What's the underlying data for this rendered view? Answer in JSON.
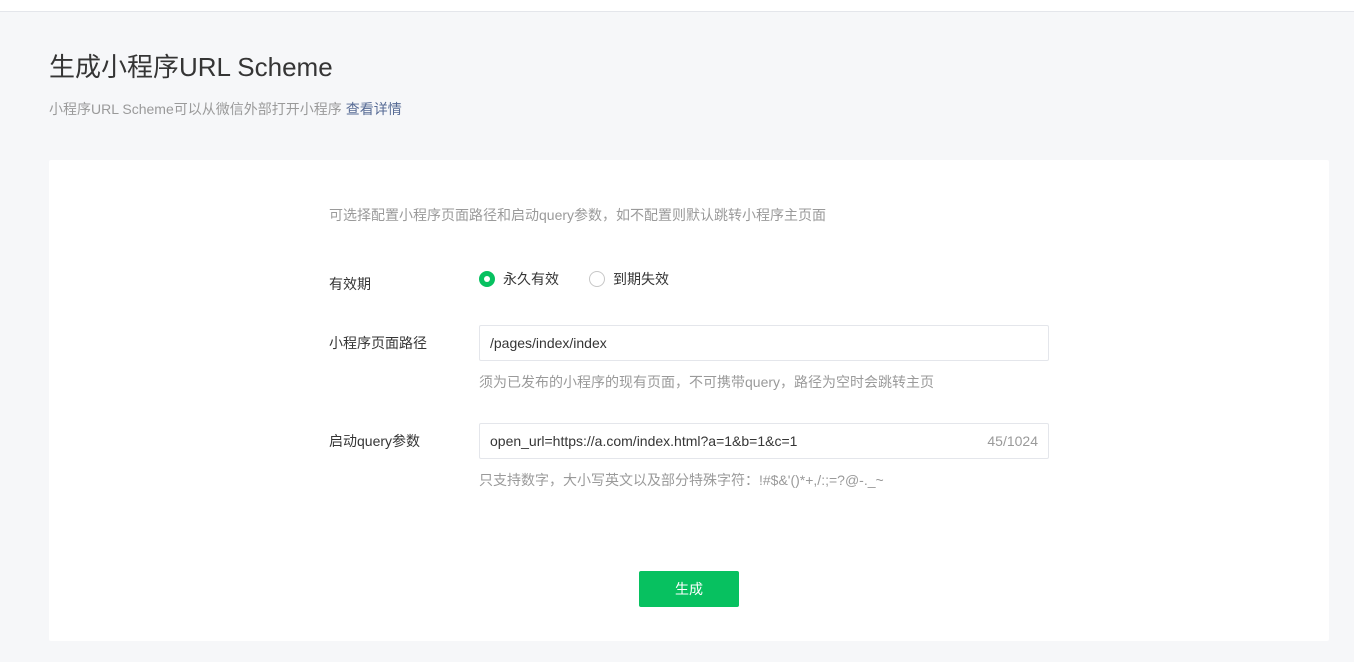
{
  "header": {
    "title": "生成小程序URL Scheme",
    "subtitle": "小程序URL Scheme可以从微信外部打开小程序",
    "details_link": "查看详情"
  },
  "form": {
    "hint": "可选择配置小程序页面路径和启动query参数，如不配置则默认跳转小程序主页面",
    "validity": {
      "label": "有效期",
      "options": [
        {
          "label": "永久有效",
          "checked": true
        },
        {
          "label": "到期失效",
          "checked": false
        }
      ]
    },
    "page_path": {
      "label": "小程序页面路径",
      "value": "/pages/index/index",
      "tip": "须为已发布的小程序的现有页面，不可携带query，路径为空时会跳转主页"
    },
    "query": {
      "label": "启动query参数",
      "value": "open_url=https://a.com/index.html?a=1&b=1&c=1",
      "counter": "45/1024",
      "tip": "只支持数字，大小写英文以及部分特殊字符：!#$&'()*+,/:;=?@-._~"
    },
    "submit_label": "生成"
  },
  "colors": {
    "primary": "#07c160",
    "link": "#576b95"
  }
}
